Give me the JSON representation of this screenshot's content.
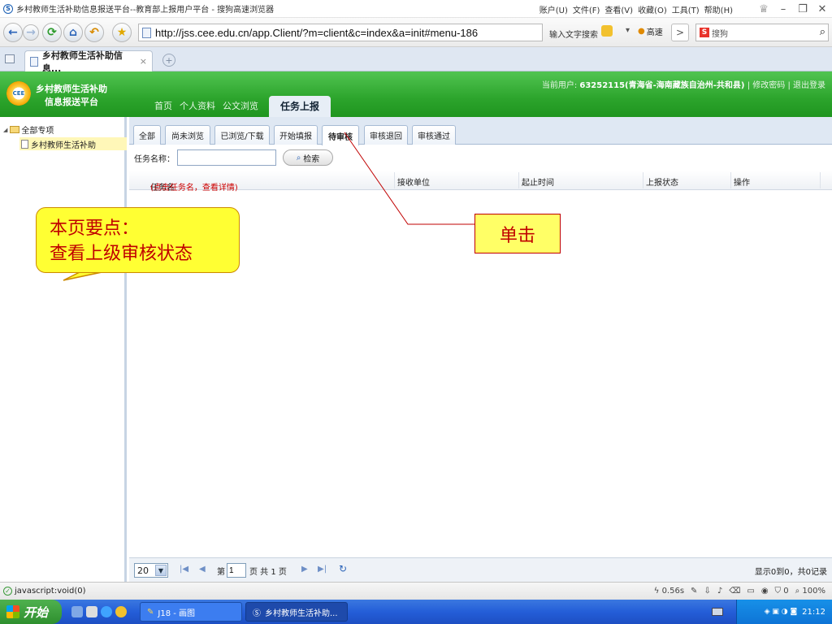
{
  "browser": {
    "title": "乡村教师生活补助信息报送平台--教育部上报用户平台 - 搜狗高速浏览器",
    "menus": [
      "账户(U)",
      "文件(F)",
      "查看(V)",
      "收藏(O)",
      "工具(T)",
      "帮助(H)"
    ],
    "url": "http://jss.cee.edu.cn/app.Client/?m=client&c=index&a=init#menu-186",
    "search_hint": "输入文字搜索",
    "speed_label": "高速",
    "search_engine": "搜狗",
    "tab_title": "乡村教师生活补助信息...",
    "tab_close": "×"
  },
  "app": {
    "logo_text": "CEE",
    "title_line1": "乡村教师生活补助",
    "title_line2": "信息报送平台",
    "nav": [
      "首页",
      "个人资料",
      "公文浏览",
      "任务上报"
    ],
    "active_nav": "任务上报",
    "user_label": "当前用户:",
    "user_value": "63252115(青海省-海南藏族自治州-共和县)",
    "change_password": "修改密码",
    "logout": "退出登录",
    "sep": "|"
  },
  "tree": {
    "root": "全部专项",
    "child": "乡村教师生活补助",
    "toggle": "◢"
  },
  "tabs": [
    "全部",
    "尚未浏览",
    "已浏览/下载",
    "开始填报",
    "待审核",
    "审核退回",
    "审核通过"
  ],
  "active_tab": "待审核",
  "search": {
    "label": "任务名称：",
    "value": "",
    "button": "检索"
  },
  "grid": {
    "col_name": "任务名",
    "col_name_hint": "(点击任务名，查看详情)",
    "col_unit": "接收单位",
    "col_time": "起止时间",
    "col_status": "上报状态",
    "col_action": "操作"
  },
  "pager": {
    "page_size": "20",
    "page_prefix": "第",
    "page_value": "1",
    "page_suffix": "页 共 1 页",
    "summary": "显示0到0，共0记录"
  },
  "statusbar": {
    "left": "javascript:void(0)",
    "timing": "0.56s",
    "count": "0",
    "zoom": "100%"
  },
  "taskbar": {
    "start": "开始",
    "task1": "J18 - 画图",
    "task2": "乡村教师生活补助...",
    "clock": "21:12"
  },
  "annotations": {
    "note_line1": "本页要点：",
    "note_line2": "查看上级审核状态",
    "click_label": "单击"
  }
}
